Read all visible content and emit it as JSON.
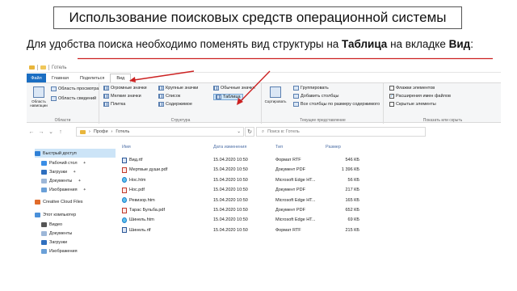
{
  "title": "Использование поисковых средств операционной системы",
  "intro": {
    "part1": "Для удобства поиска необходимо поменять вид структуры на ",
    "bold1": "Таблица",
    "part2": " на вкладке ",
    "bold2": "Вид",
    "part3": ":"
  },
  "window": {
    "titlebar": "Готель"
  },
  "tabs": [
    "Файл",
    "Главная",
    "Поделиться",
    "Вид"
  ],
  "ribbon": {
    "panes": {
      "nav_area": "Область навигации",
      "preview": "Область просмотра",
      "details": "Область сведений",
      "label": "Области"
    },
    "layout": {
      "xl_icons": "Огромные значки",
      "l_icons": "Крупные значки",
      "m_icons": "Обычные значки",
      "s_icons": "Мелкие значки",
      "list": "Список",
      "table": "Таблица",
      "tiles": "Плитка",
      "content": "Содержимое",
      "label": "Структура"
    },
    "current_view": {
      "sort": "Сортировать",
      "group": "Группировать",
      "add_columns": "Добавить столбцы",
      "fit_columns": "Все столбцы по размеру содержимого",
      "label": "Текущее представление"
    },
    "show_hide": {
      "item_flags": "Флажки элементов",
      "extensions": "Расширения имен файлов",
      "hidden": "Скрытые элементы",
      "label": "Показать или скрыть"
    }
  },
  "address": {
    "path_root": "Профи",
    "path_leaf": "Готель",
    "search_placeholder": "Поиск в: Готель"
  },
  "nav_pane": {
    "items": [
      {
        "label": "Быстрый доступ",
        "icon": "star-icon"
      },
      {
        "label": "Рабочий стол",
        "icon": "desktop-icon",
        "pin": true
      },
      {
        "label": "Загрузки",
        "icon": "download-icon",
        "pin": true
      },
      {
        "label": "Документы",
        "icon": "documents-icon",
        "pin": true
      },
      {
        "label": "Изображения",
        "icon": "images-icon",
        "pin": true
      },
      {
        "label": "Creative Cloud Files",
        "icon": "cloud-icon"
      },
      {
        "label": "Этот компьютер",
        "icon": "computer-icon"
      },
      {
        "label": "Видео",
        "icon": "video-icon"
      },
      {
        "label": "Документы",
        "icon": "documents-icon"
      },
      {
        "label": "Загрузки",
        "icon": "download-icon"
      },
      {
        "label": "Изображения",
        "icon": "images-icon"
      }
    ]
  },
  "columns": [
    "Имя",
    "Дата изменения",
    "Тип",
    "Размер"
  ],
  "files": [
    {
      "name": "Вид.rtf",
      "date": "15.04.2020 10:50",
      "type": "Формат RTF",
      "size": "546 КБ",
      "kind": "rtf"
    },
    {
      "name": "Мертвые души.pdf",
      "date": "15.04.2020 10:50",
      "type": "Документ PDF",
      "size": "1 396 КБ",
      "kind": "pdf"
    },
    {
      "name": "Нос.htm",
      "date": "15.04.2020 10:50",
      "type": "Microsoft Edge HT...",
      "size": "56 КБ",
      "kind": "edge"
    },
    {
      "name": "Нос.pdf",
      "date": "15.04.2020 10:50",
      "type": "Документ PDF",
      "size": "217 КБ",
      "kind": "pdf"
    },
    {
      "name": "Ревизор.htm",
      "date": "15.04.2020 10:50",
      "type": "Microsoft Edge HT...",
      "size": "165 КБ",
      "kind": "edge"
    },
    {
      "name": "Тарас Бульба.pdf",
      "date": "15.04.2020 10:50",
      "type": "Документ PDF",
      "size": "652 КБ",
      "kind": "pdf"
    },
    {
      "name": "Шинель.htm",
      "date": "15.04.2020 10:50",
      "type": "Microsoft Edge HT...",
      "size": "69 КБ",
      "kind": "edge"
    },
    {
      "name": "Шинель.rtf",
      "date": "15.04.2020 10:50",
      "type": "Формат RTF",
      "size": "215 КБ",
      "kind": "rtf"
    }
  ],
  "colors": {
    "accent": "#1b6ec2",
    "annotation": "#cc2222",
    "selection": "#cce4f7"
  }
}
